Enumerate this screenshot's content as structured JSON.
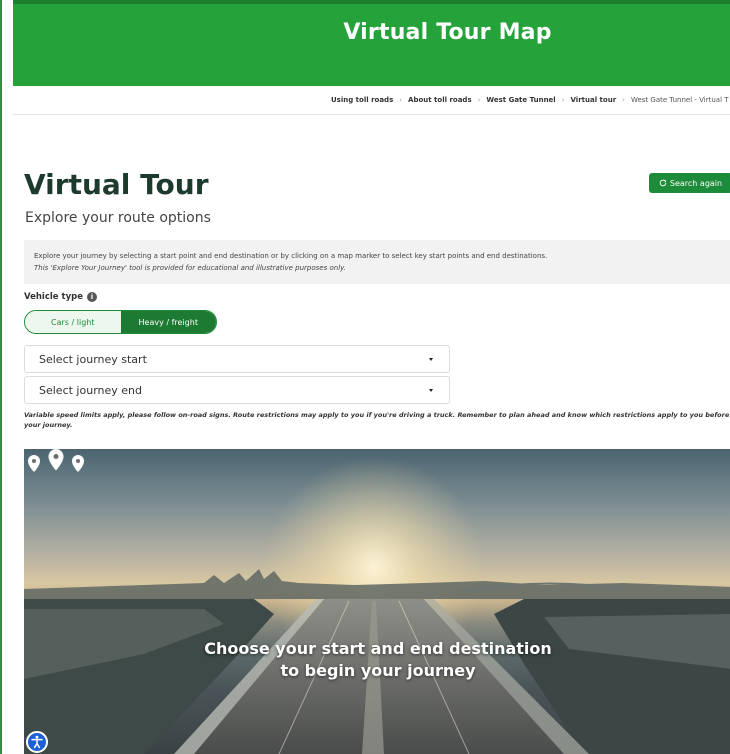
{
  "header": {
    "title": "Virtual Tour Map"
  },
  "breadcrumb": [
    "Using toll roads",
    "About toll roads",
    "West Gate Tunnel",
    "Virtual tour",
    "West Gate Tunnel - Virtual T"
  ],
  "main": {
    "title": "Virtual Tour",
    "subtitle": "Explore your route options",
    "search_again_label": "Search again",
    "info_line1": "Explore your journey by selecting a start point and end destination or by clicking on a map marker to select key start points and end destinations.",
    "info_line2": "This 'Explore Your Journey' tool is provided for educational and illustrative purposes only.",
    "vehicle_type_label": "Vehicle type",
    "vehicle_options": [
      "Cars / light",
      "Heavy / freight"
    ],
    "vehicle_selected": "Heavy / freight",
    "journey_start_placeholder": "Select journey start",
    "journey_end_placeholder": "Select journey end",
    "notice": "Variable speed limits apply, please follow on-road signs. Route restrictions may apply to you if you're driving a truck. Remember to plan ahead and know which restrictions apply to you before your journey.",
    "hero_line1": "Choose your start and end destination",
    "hero_line2": "to begin your journey"
  },
  "colors": {
    "brand_green": "#25a23a",
    "button_green": "#1d8c3a",
    "accessibility_blue": "#1f5fd6"
  },
  "icons": [
    "refresh-icon",
    "info-icon",
    "chevron-down-icon",
    "map-pin-icon",
    "accessibility-icon"
  ]
}
